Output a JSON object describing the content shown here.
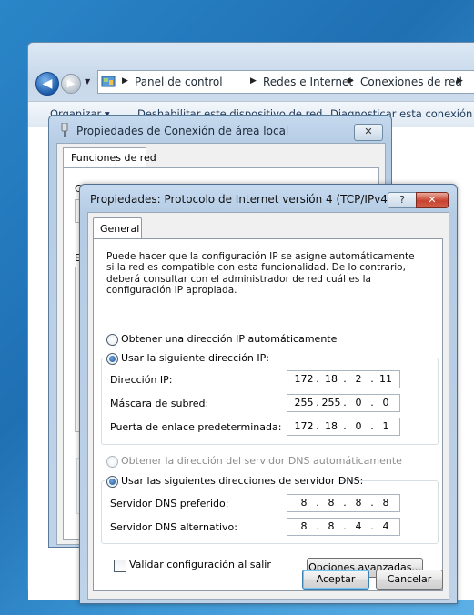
{
  "explorer": {
    "breadcrumb": [
      "Panel de control",
      "Redes e Internet",
      "Conexiones de red"
    ],
    "toolbar": {
      "organize": "Organizar ▾",
      "disable": "Deshabilitar este dispositivo de red",
      "diagnose": "Diagnosticar esta conexión"
    }
  },
  "lan_dialog": {
    "title": "Propiedades de Conexión de área local",
    "close_glyph": "✕",
    "tab": "Funciones de red",
    "frag_c": "C",
    "frag_e": "E"
  },
  "ipv4_dialog": {
    "title": "Propiedades: Protocolo de Internet versión 4 (TCP/IPv4)",
    "help_glyph": "?",
    "close_glyph": "✕",
    "tab": "General",
    "description": "Puede hacer que la configuración IP se asigne automáticamente si la red es compatible con esta funcionalidad. De lo contrario, deberá consultar con el administrador de red cuál es la configuración IP apropiada.",
    "ip_auto_label": "Obtener una dirección IP automáticamente",
    "ip_manual_label": "Usar la siguiente dirección IP:",
    "ip_address_label": "Dirección IP:",
    "ip_address": [
      "172",
      "18",
      "2",
      "11"
    ],
    "subnet_label": "Máscara de subred:",
    "subnet": [
      "255",
      "255",
      "0",
      "0"
    ],
    "gateway_label": "Puerta de enlace predeterminada:",
    "gateway": [
      "172",
      "18",
      "0",
      "1"
    ],
    "dns_auto_label": "Obtener la dirección del servidor DNS automáticamente",
    "dns_manual_label": "Usar las siguientes direcciones de servidor DNS:",
    "dns_pref_label": "Servidor DNS preferido:",
    "dns_pref": [
      "8",
      "8",
      "8",
      "8"
    ],
    "dns_alt_label": "Servidor DNS alternativo:",
    "dns_alt": [
      "8",
      "8",
      "4",
      "4"
    ],
    "validate_label": "Validar configuración al salir",
    "advanced_button": "Opciones avanzadas...",
    "accept_button": "Aceptar",
    "cancel_button": "Cancelar"
  },
  "state": {
    "ip_mode": "manual",
    "dns_mode": "manual",
    "validate_checked": false
  }
}
